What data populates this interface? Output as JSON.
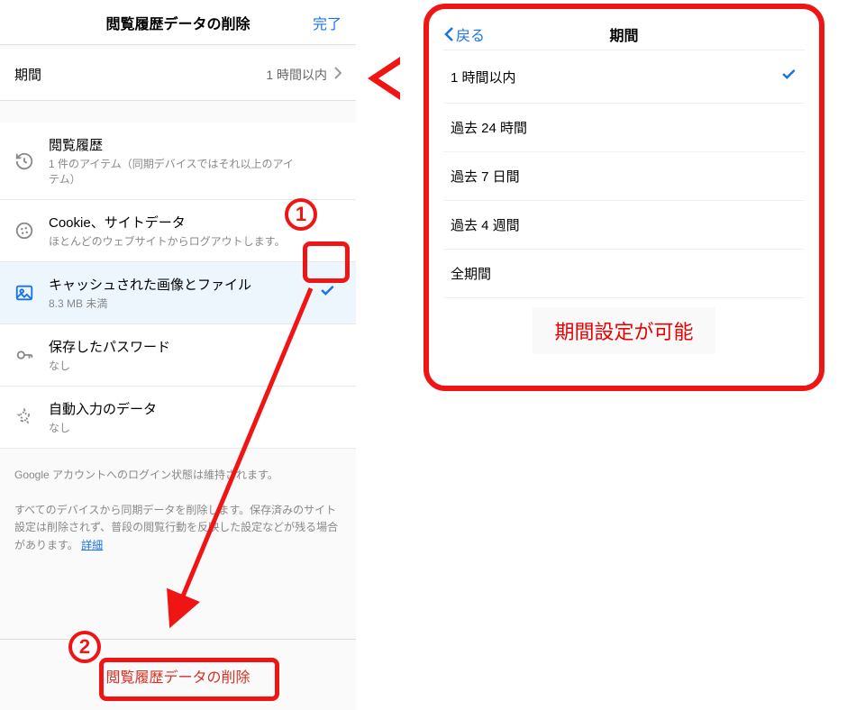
{
  "left": {
    "header_title": "閲覧履歴データの削除",
    "done_label": "完了",
    "period_label": "期間",
    "period_value": "1 時間以内",
    "items": [
      {
        "title": "閲覧履歴",
        "sub": "1 件のアイテム（同期デバイスではそれ以上のアイテム）",
        "checked": false
      },
      {
        "title": "Cookie、サイトデータ",
        "sub": "ほとんどのウェブサイトからログアウトします。",
        "checked": false
      },
      {
        "title": "キャッシュされた画像とファイル",
        "sub": "8.3 MB 未満",
        "checked": true
      },
      {
        "title": "保存したパスワード",
        "sub": "なし",
        "checked": false
      },
      {
        "title": "自動入力のデータ",
        "sub": "なし",
        "checked": false
      }
    ],
    "footer1": "Google アカウントへのログイン状態は維持されます。",
    "footer2": "すべてのデバイスから同期データを削除します。保存済みのサイト設定は削除されず、普段の閲覧行動を反映した設定などが残る場合があります。",
    "detail_link": "詳細",
    "delete_label": "閲覧履歴データの削除"
  },
  "right": {
    "back_label": "戻る",
    "title": "期間",
    "options": [
      {
        "label": "1 時間以内",
        "checked": true
      },
      {
        "label": "過去 24 時間",
        "checked": false
      },
      {
        "label": "過去 7 日間",
        "checked": false
      },
      {
        "label": "過去 4 週間",
        "checked": false
      },
      {
        "label": "全期間",
        "checked": false
      }
    ],
    "callout": "期間設定が可能"
  },
  "annotations": {
    "badge1": "1",
    "badge2": "2"
  }
}
